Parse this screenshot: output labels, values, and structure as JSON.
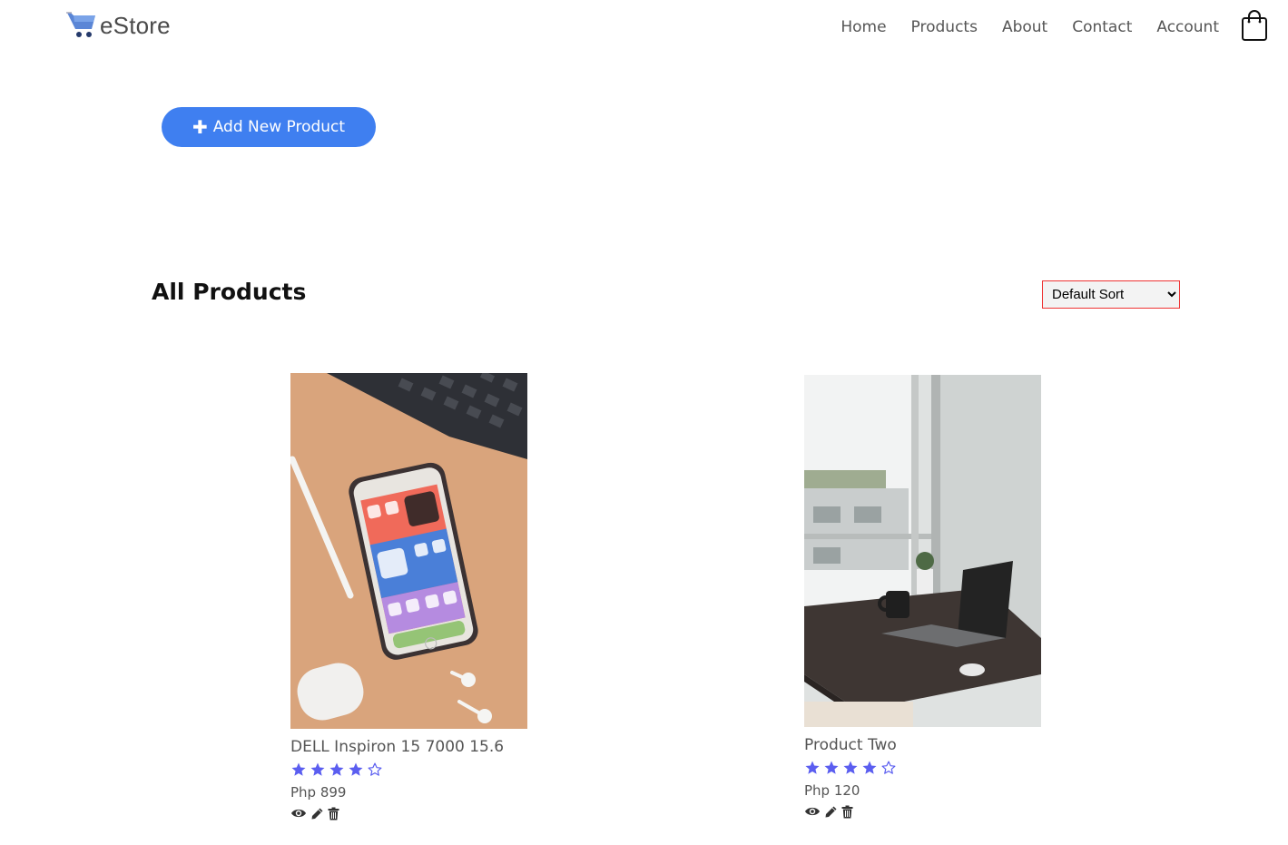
{
  "header": {
    "logo_text": "eStore",
    "nav": [
      "Home",
      "Products",
      "About",
      "Contact",
      "Account"
    ],
    "cart_icon": "shopping-bag-icon"
  },
  "toolbar": {
    "add_button_label": "Add New Product",
    "add_button_icon": "plus-icon"
  },
  "section": {
    "title": "All Products",
    "sort_selected": "Default Sort"
  },
  "products": [
    {
      "name": "DELL Inspiron 15 7000 15.6",
      "rating": 4,
      "rating_max": 5,
      "price": "Php 899",
      "image": "smartphone-on-desk-photo"
    },
    {
      "name": "Product Two",
      "rating": 4,
      "rating_max": 5,
      "price": "Php 120",
      "image": "laptop-on-table-photo"
    }
  ],
  "colors": {
    "accent": "#3f7ff0",
    "star": "#5b5ef0",
    "sort_border": "#ee3333"
  },
  "product_actions": [
    "view-icon",
    "edit-icon",
    "delete-icon"
  ]
}
